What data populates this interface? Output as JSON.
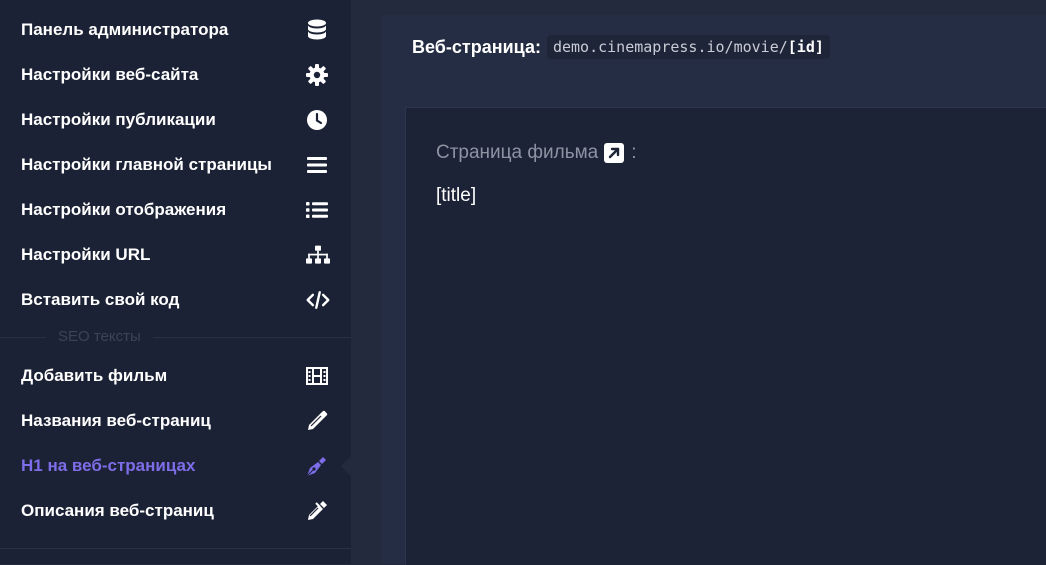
{
  "sidebar": {
    "items": [
      {
        "label": "Панель администратора",
        "icon": "database-icon"
      },
      {
        "label": "Настройки веб-сайта",
        "icon": "gear-icon"
      },
      {
        "label": "Настройки публикации",
        "icon": "clock-icon"
      },
      {
        "label": "Настройки главной страницы",
        "icon": "bars-icon"
      },
      {
        "label": "Настройки отображения",
        "icon": "list-icon"
      },
      {
        "label": "Настройки URL",
        "icon": "sitemap-icon"
      },
      {
        "label": "Вставить свой код",
        "icon": "code-icon"
      }
    ],
    "section_title": "SEO тексты",
    "seo_items": [
      {
        "label": "Добавить фильм",
        "icon": "film-icon"
      },
      {
        "label": "Названия веб-страниц",
        "icon": "pencil-icon"
      },
      {
        "label": "H1 на веб-страницах",
        "icon": "pen-nib-icon"
      },
      {
        "label": "Описания веб-страниц",
        "icon": "marker-icon"
      }
    ],
    "active_item": "H1 на веб-страницах"
  },
  "main": {
    "header_label": "Веб-страница:",
    "url_prefix": "demo.cinemapress.io/movie/",
    "url_param": "[id]",
    "field_label": "Страница фильма",
    "field_colon": ":",
    "field_value": "[title]"
  },
  "colors": {
    "sidebar_bg": "#1c2235",
    "main_bg": "#232a3d",
    "accent": "#7d6de8",
    "text": "#ffffff"
  }
}
